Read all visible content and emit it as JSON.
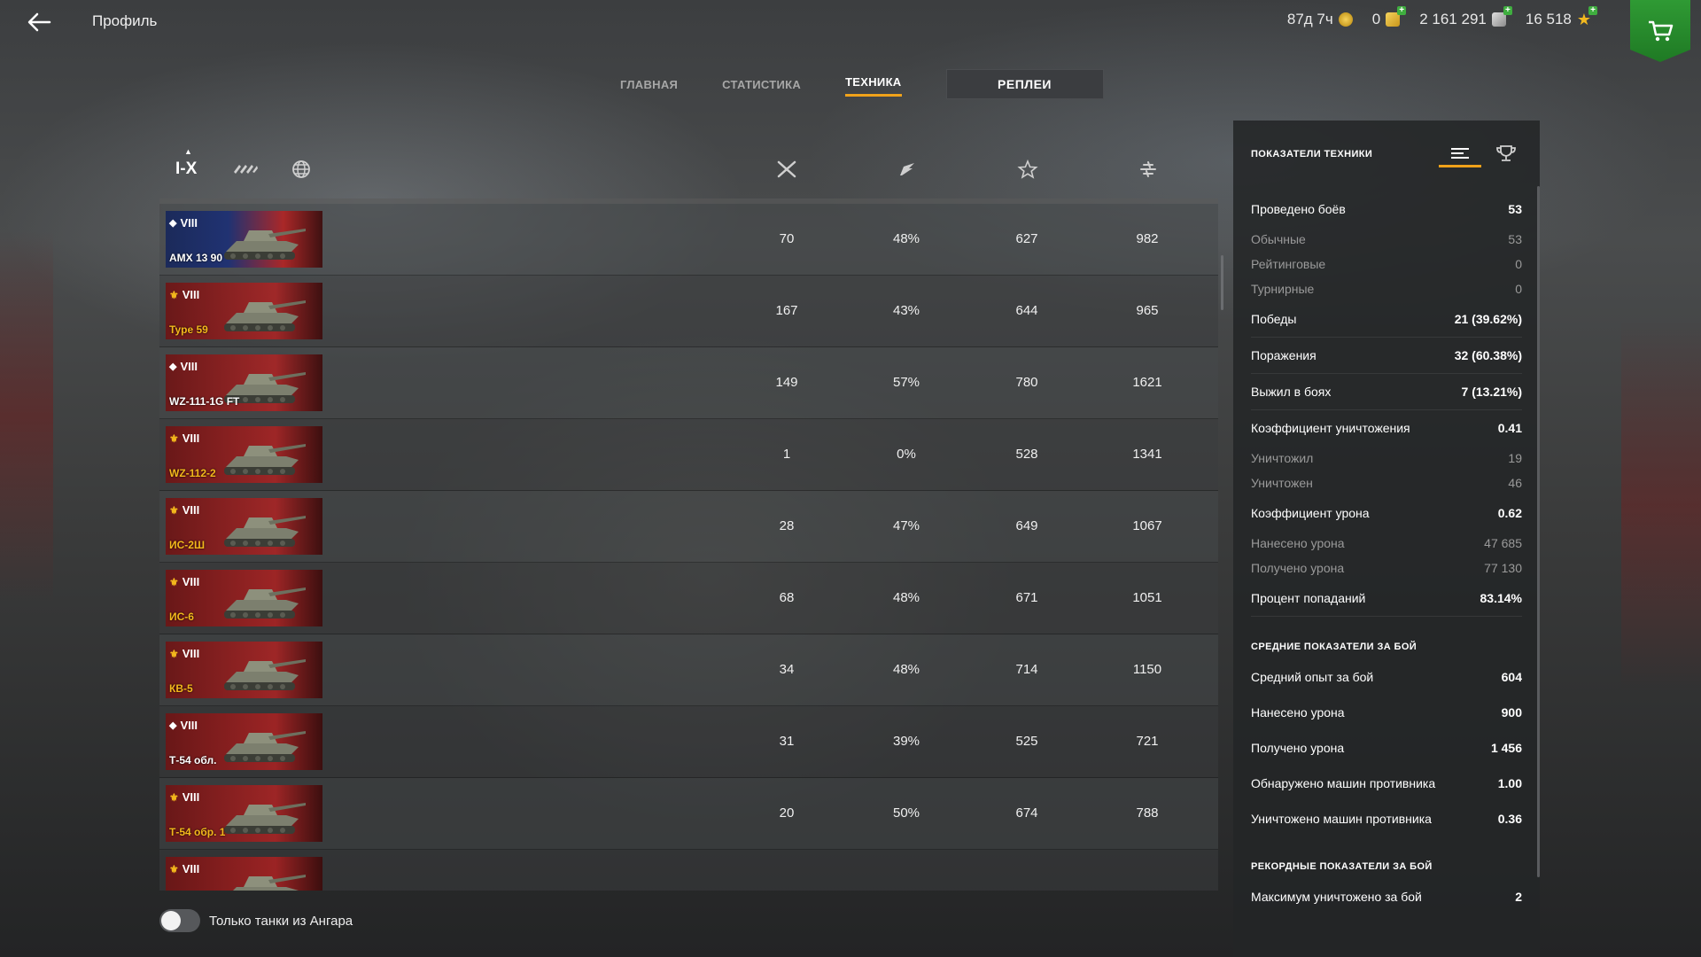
{
  "header": {
    "back_icon": "arrow-left-icon",
    "title": "Профиль",
    "currencies": [
      {
        "name": "premium",
        "value": "87д 7ч",
        "icon": "premium-icon"
      },
      {
        "name": "gold",
        "value": "0",
        "icon": "gold-icon"
      },
      {
        "name": "credits",
        "value": "2 161 291",
        "icon": "credits-icon"
      },
      {
        "name": "free_xp",
        "value": "16 518",
        "icon": "star-icon"
      }
    ],
    "shop_icon": "cart-icon"
  },
  "tabs": [
    {
      "label": "ГЛАВНАЯ",
      "active": false
    },
    {
      "label": "СТАТИСТИКА",
      "active": false
    },
    {
      "label": "ТЕХНИКА",
      "active": true
    },
    {
      "label": "РЕПЛЕИ",
      "active": false
    }
  ],
  "filters": {
    "tier_label": "I-X",
    "columns_icons": [
      "battles-icon",
      "winrate-icon",
      "mastery-star-icon",
      "avg-damage-icon"
    ]
  },
  "vehicles": [
    {
      "tier": "VIII",
      "name": "AMX 13 90",
      "battles": "70",
      "winrate": "48%",
      "col3": "627",
      "col4": "982",
      "premium": false,
      "card": "blue"
    },
    {
      "tier": "VIII",
      "name": "Type 59",
      "battles": "167",
      "winrate": "43%",
      "col3": "644",
      "col4": "965",
      "premium": true,
      "card": "red"
    },
    {
      "tier": "VIII",
      "name": "WZ-111-1G FT",
      "battles": "149",
      "winrate": "57%",
      "col3": "780",
      "col4": "1621",
      "premium": false,
      "card": "red"
    },
    {
      "tier": "VIII",
      "name": "WZ-112-2",
      "battles": "1",
      "winrate": "0%",
      "col3": "528",
      "col4": "1341",
      "premium": true,
      "card": "red"
    },
    {
      "tier": "VIII",
      "name": "ИС-2Ш",
      "battles": "28",
      "winrate": "47%",
      "col3": "649",
      "col4": "1067",
      "premium": true,
      "card": "red"
    },
    {
      "tier": "VIII",
      "name": "ИС-6",
      "battles": "68",
      "winrate": "48%",
      "col3": "671",
      "col4": "1051",
      "premium": true,
      "card": "red"
    },
    {
      "tier": "VIII",
      "name": "КВ-5",
      "battles": "34",
      "winrate": "48%",
      "col3": "714",
      "col4": "1150",
      "premium": true,
      "card": "red"
    },
    {
      "tier": "VIII",
      "name": "Т-54 обл.",
      "battles": "31",
      "winrate": "39%",
      "col3": "525",
      "col4": "721",
      "premium": false,
      "card": "red"
    },
    {
      "tier": "VIII",
      "name": "Т-54 обр. 1",
      "battles": "20",
      "winrate": "50%",
      "col3": "674",
      "col4": "788",
      "premium": true,
      "card": "red"
    },
    {
      "tier": "VIII",
      "name": "",
      "battles": "",
      "winrate": "",
      "col3": "",
      "col4": "",
      "premium": true,
      "card": "red"
    }
  ],
  "toggle": {
    "label": "Только танки из Ангара",
    "on": false
  },
  "panel": {
    "title": "ПОКАЗАТЕЛИ ТЕХНИКИ",
    "icons": [
      "list-icon",
      "trophy-icon"
    ],
    "stats": [
      {
        "label": "Проведено боёв",
        "value": "53",
        "kind": "main"
      },
      {
        "label": "Обычные",
        "value": "53",
        "kind": "sub"
      },
      {
        "label": "Рейтинговые",
        "value": "0",
        "kind": "sub"
      },
      {
        "label": "Турнирные",
        "value": "0",
        "kind": "sub"
      },
      {
        "label": "Победы",
        "value": "21 (39.62%)",
        "kind": "main"
      },
      {
        "label": "Поражения",
        "value": "32 (60.38%)",
        "kind": "main"
      },
      {
        "label": "Выжил в боях",
        "value": "7 (13.21%)",
        "kind": "main"
      },
      {
        "label": "Коэффициент уничтожения",
        "value": "0.41",
        "kind": "main"
      },
      {
        "label": "Уничтожил",
        "value": "19",
        "kind": "sub"
      },
      {
        "label": "Уничтожен",
        "value": "46",
        "kind": "sub"
      },
      {
        "label": "Коэффициент урона",
        "value": "0.62",
        "kind": "main"
      },
      {
        "label": "Нанесено урона",
        "value": "47 685",
        "kind": "sub"
      },
      {
        "label": "Получено урона",
        "value": "77 130",
        "kind": "sub"
      },
      {
        "label": "Процент попаданий",
        "value": "83.14%",
        "kind": "main"
      }
    ],
    "avg_title": "СРЕДНИЕ ПОКАЗАТЕЛИ ЗА БОЙ",
    "avg_stats": [
      {
        "label": "Средний опыт за бой",
        "value": "604"
      },
      {
        "label": "Нанесено урона",
        "value": "900"
      },
      {
        "label": "Получено урона",
        "value": "1 456"
      },
      {
        "label": "Обнаружено машин противника",
        "value": "1.00"
      },
      {
        "label": "Уничтожено машин противника",
        "value": "0.36"
      }
    ],
    "record_title": "РЕКОРДНЫЕ ПОКАЗАТЕЛИ ЗА БОЙ",
    "record_stats": [
      {
        "label": "Максимум уничтожено за бой",
        "value": "2"
      }
    ]
  },
  "colors": {
    "accent": "#f0a21a",
    "shop": "#2f9a34",
    "premium_name": "#f4b81c"
  }
}
